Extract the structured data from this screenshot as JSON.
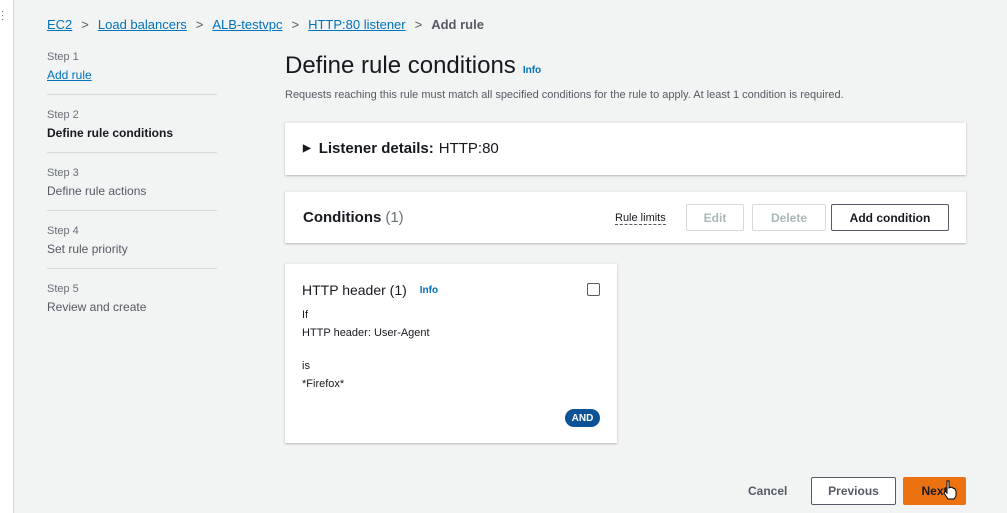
{
  "breadcrumb": {
    "items": [
      "EC2",
      "Load balancers",
      "ALB-testvpc",
      "HTTP:80 listener"
    ],
    "current": "Add rule"
  },
  "steps": [
    {
      "num": "Step 1",
      "label": "Add rule"
    },
    {
      "num": "Step 2",
      "label": "Define rule conditions"
    },
    {
      "num": "Step 3",
      "label": "Define rule actions"
    },
    {
      "num": "Step 4",
      "label": "Set rule priority"
    },
    {
      "num": "Step 5",
      "label": "Review and create"
    }
  ],
  "header": {
    "title": "Define rule conditions",
    "info": "Info",
    "description": "Requests reaching this rule must match all specified conditions for the rule to apply. At least 1 condition is required."
  },
  "listener": {
    "label": "Listener details:",
    "value": "HTTP:80"
  },
  "conditions": {
    "title": "Conditions",
    "count": "(1)",
    "rule_limits": "Rule limits",
    "edit": "Edit",
    "delete": "Delete",
    "add": "Add condition"
  },
  "card": {
    "title": "HTTP header (1)",
    "info": "Info",
    "if_label": "If",
    "header_line": "HTTP header: User-Agent",
    "is_label": "is",
    "value": "*Firefox*",
    "badge": "AND"
  },
  "footer": {
    "cancel": "Cancel",
    "previous": "Previous",
    "next": "Next"
  },
  "colors": {
    "link": "#0073bb",
    "primary": "#ec7211",
    "badge": "#0b5394"
  }
}
